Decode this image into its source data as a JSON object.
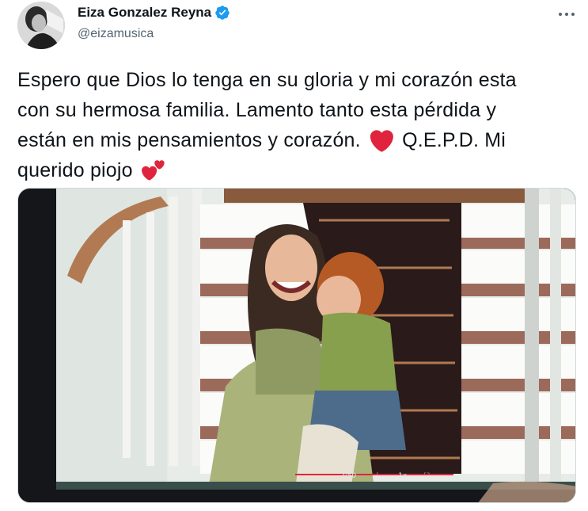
{
  "author": {
    "display_name": "Eiza Gonzalez Reyna",
    "handle": "@eizamusica",
    "avatar_icon": "profile-photo",
    "verified_icon": "verified-badge-icon"
  },
  "tweet": {
    "line1": "Espero que Dios lo tenga en su gloria y mi corazón esta",
    "line2": "con su hermosa familia. Lamento tanto esta pérdida y",
    "line3_before_emoji": "están en mis pensamientos y corazón.",
    "line3_after_emoji": "Q.E.P.D. Mi",
    "line4": "querido piojo",
    "emoji_1": "red-heart",
    "emoji_2": "two-hearts"
  },
  "media": {
    "description_icon": "photo-of-tv-screen",
    "controls": [
      "2:50",
      "⋮",
      "1x",
      "⛶"
    ]
  },
  "colors": {
    "text_primary": "#0f1419",
    "text_secondary": "#536471",
    "verified_blue": "#1d9bf0",
    "heart_red": "#e0243d"
  }
}
